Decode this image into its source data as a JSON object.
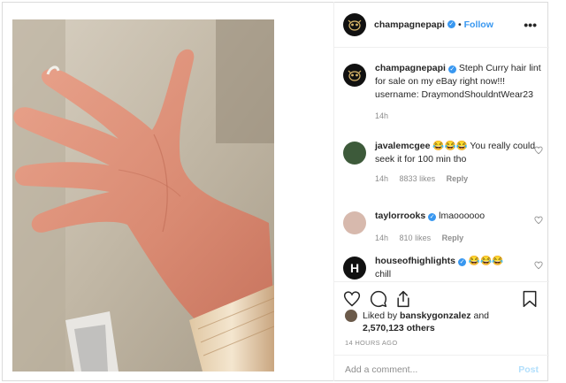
{
  "header": {
    "username": "champagnepapi",
    "separator": "•",
    "follow_label": "Follow",
    "more_label": "•••"
  },
  "caption": {
    "username": "champagnepapi",
    "text": "Steph Curry hair lint for sale on my eBay right now!!! username: DraymondShouldntWear23",
    "time": "14h"
  },
  "comments": [
    {
      "username": "javalemcgee",
      "text": "😂😂😂 You really could seek it for 100 min tho",
      "time": "14h",
      "likes": "8833 likes",
      "reply": "Reply",
      "verified": false
    },
    {
      "username": "taylorrooks",
      "text": "lmaoooooo",
      "time": "14h",
      "likes": "810 likes",
      "reply": "Reply",
      "verified": true
    },
    {
      "username": "houseofhighlights",
      "text": "😂😂😂",
      "text2": "chill",
      "verified": true,
      "avatar_letter": "H"
    }
  ],
  "likes": {
    "prefix": "Liked by",
    "user": "banskygonzalez",
    "and": "and",
    "count": "2,570,123 others"
  },
  "time_ago": "14 HOURS AGO",
  "add_comment": {
    "placeholder": "Add a comment...",
    "post_label": "Post"
  },
  "icons": {
    "more": "more-options-icon",
    "heart": "heart-icon",
    "comment": "comment-icon",
    "share": "share-icon",
    "save": "bookmark-icon",
    "verified": "verified-badge-icon"
  },
  "colors": {
    "link": "#3897f0",
    "muted": "#8e8e8e",
    "text": "#262626",
    "post_disabled": "#b2dffc"
  }
}
